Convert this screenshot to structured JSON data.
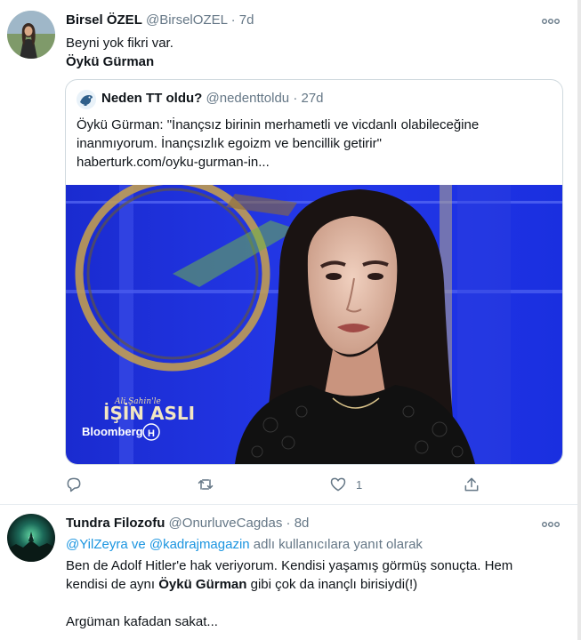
{
  "tweet1": {
    "name": "Birsel ÖZEL",
    "handle": "@BirselOZEL",
    "separator": "·",
    "time": "7d",
    "line1": "Beyni yok fikri var.",
    "line2": "Öykü Gürman",
    "quote": {
      "name": "Neden TT oldu?",
      "handle": "@nedenttoldu",
      "separator": "·",
      "time": "27d",
      "text_line1": "Öykü Gürman: \"İnançsız birinin merhametli ve vicdanlı olabileceğine",
      "text_line2": "inanmıyorum. İnançsızlık egoizm ve bencillik getirir\"",
      "text_line3": "haberturk.com/oyku-gurman-in...",
      "media": {
        "show_title": "İŞİN ASLI",
        "show_script": "Ali Şahin'le",
        "channel": "Bloomberg"
      }
    },
    "actions": {
      "reply_icon": "reply-icon",
      "retweet_icon": "retweet-icon",
      "like_icon": "heart-icon",
      "like_count": "1",
      "share_icon": "share-icon"
    }
  },
  "tweet2": {
    "name": "Tundra Filozofu",
    "handle": "@OnurluveCagdas",
    "separator": "·",
    "time": "8d",
    "reply_mentions": "@YilZeyra ve @kadrajmagazin",
    "reply_suffix": " adlı kullanıcılara yanıt olarak",
    "line1": "Ben de Adolf Hitler'e hak veriyorum. Kendisi yaşamış görmüş sonuçta. Hem",
    "line2_pre": "kendisi de aynı ",
    "line2_bold": "Öykü Gürman",
    "line2_post": " gibi çok da inançlı birisiydi(!)",
    "line3": "Argüman kafadan sakat..."
  },
  "colors": {
    "accent": "#1b95e0",
    "muted": "#657786",
    "border": "#cfd9de",
    "studio_blue": "#1c2fd6"
  }
}
